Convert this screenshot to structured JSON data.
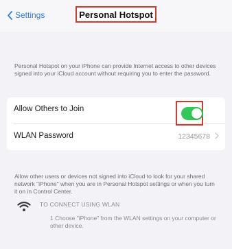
{
  "navbar": {
    "back_label": "Settings",
    "title": "Personal Hotspot"
  },
  "description": "Personal Hotspot on your iPhone can provide Internet access to other devices signed into your iCloud account without requiring you to enter the password.",
  "settings": {
    "allow_label": "Allow Others to Join",
    "allow_enabled": true,
    "wlan_label": "WLAN Password",
    "wlan_value": "12345678"
  },
  "note": "Allow other users or devices not signed into iCloud to look for your shared network \"iPhone\" when you are in Personal Hotspot settings or when you turn it on in Control Center.",
  "connect": {
    "title": "TO CONNECT USING WLAN",
    "step": "1 Choose \"iPhone\" from the WLAN settings on your computer or other device."
  },
  "colors": {
    "accent": "#2d7bf6",
    "toggle_on": "#34c759",
    "highlight": "#d33a2f"
  }
}
